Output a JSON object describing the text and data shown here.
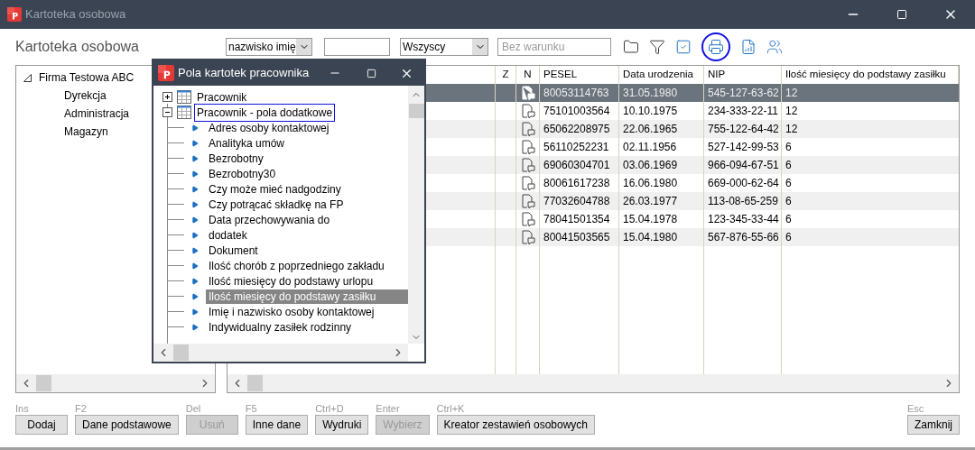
{
  "window": {
    "title": "Kartoteka osobowa"
  },
  "heading": "Kartoteka osobowa",
  "filters": {
    "sort": "nazwisko imię",
    "group": "Wszyscy",
    "condition_placeholder": "Bez warunku"
  },
  "tree": [
    {
      "label": "Firma Testowa ABC",
      "expanded": true,
      "children": [
        {
          "label": "Dyrekcja"
        },
        {
          "label": "Administracja"
        },
        {
          "label": "Magazyn"
        }
      ]
    }
  ],
  "table": {
    "columns": [
      "Z",
      "N",
      "PESEL",
      "Data urodzenia",
      "NIP",
      "Ilość miesięcy do podstawy zasiłku"
    ],
    "rows": [
      {
        "selected": true,
        "pesel": "80053114763",
        "birth": "31.05.1980",
        "nip": "545-127-63-62",
        "months": "12"
      },
      {
        "selected": false,
        "pesel": "75101003564",
        "birth": "10.10.1975",
        "nip": "234-333-22-11",
        "months": "12"
      },
      {
        "selected": false,
        "pesel": "65062208975",
        "birth": "22.06.1965",
        "nip": "755-122-64-42",
        "months": "12"
      },
      {
        "selected": false,
        "pesel": "56110252231",
        "birth": "02.11.1956",
        "nip": "527-142-99-53",
        "months": "6"
      },
      {
        "selected": false,
        "pesel": "69060304701",
        "birth": "03.06.1969",
        "nip": "966-094-67-51",
        "months": "6"
      },
      {
        "selected": false,
        "pesel": "80061617238",
        "birth": "16.06.1980",
        "nip": "669-000-62-64",
        "months": "6"
      },
      {
        "selected": false,
        "pesel": "77032604788",
        "birth": "26.03.1977",
        "nip": "113-08-65-259",
        "months": "6"
      },
      {
        "selected": false,
        "pesel": "78041501354",
        "birth": "15.04.1978",
        "nip": "123-345-33-44",
        "months": "6"
      },
      {
        "selected": false,
        "pesel": "80041503565",
        "birth": "15.04.1980",
        "nip": "567-876-55-66",
        "months": "6"
      }
    ]
  },
  "buttons": [
    {
      "shortcut": "Ins",
      "label": "Dodaj",
      "disabled": false
    },
    {
      "shortcut": "F2",
      "label": "Dane podstawowe",
      "disabled": false
    },
    {
      "shortcut": "Del",
      "label": "Usuń",
      "disabled": true
    },
    {
      "shortcut": "F5",
      "label": "Inne dane",
      "disabled": false
    },
    {
      "shortcut": "Ctrl+D",
      "label": "Wydruki",
      "disabled": false
    },
    {
      "shortcut": "Enter",
      "label": "Wybierz",
      "disabled": true
    },
    {
      "shortcut": "Ctrl+K",
      "label": "Kreator zestawień osobowych",
      "disabled": false
    }
  ],
  "close_button": {
    "shortcut": "Esc",
    "label": "Zamknij"
  },
  "dialog": {
    "title": "Pola kartotek pracownika",
    "items": [
      {
        "label": "Pracownik",
        "expanded": false,
        "focused": false
      },
      {
        "label": "Pracownik - pola dodatkowe",
        "expanded": true,
        "focused": true,
        "children": [
          {
            "label": "Adres osoby kontaktowej",
            "selected": false
          },
          {
            "label": "Analityka umów",
            "selected": false
          },
          {
            "label": "Bezrobotny",
            "selected": false
          },
          {
            "label": "Bezrobotny30",
            "selected": false
          },
          {
            "label": "Czy może mieć nadgodziny",
            "selected": false
          },
          {
            "label": "Czy potrącać składkę na FP",
            "selected": false
          },
          {
            "label": "Data przechowywania do",
            "selected": false
          },
          {
            "label": "dodatek",
            "selected": false
          },
          {
            "label": "Dokument",
            "selected": false
          },
          {
            "label": "Ilość chorób z poprzedniego zakładu",
            "selected": false
          },
          {
            "label": "Ilość miesięcy do podstawy urlopu",
            "selected": false
          },
          {
            "label": "Ilość miesięcy do podstawy zasiłku",
            "selected": true
          },
          {
            "label": "Imię i nazwisko osoby kontaktowej",
            "selected": false
          },
          {
            "label": "Indywidualny zasiłek rodzinny",
            "selected": false
          }
        ]
      }
    ]
  }
}
